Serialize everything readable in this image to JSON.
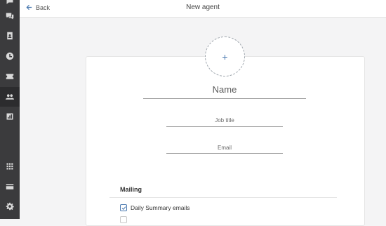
{
  "header": {
    "back_label": "Back",
    "title": "New agent"
  },
  "sidebar": {
    "items": [
      {
        "icon": "chat-icon"
      },
      {
        "icon": "contact-book-icon"
      },
      {
        "icon": "clock-icon"
      },
      {
        "icon": "tickets-icon"
      },
      {
        "icon": "agents-icon",
        "active": true
      },
      {
        "icon": "reports-icon"
      },
      {
        "icon": "apps-grid-icon"
      },
      {
        "icon": "billing-card-icon"
      },
      {
        "icon": "settings-gear-icon"
      }
    ]
  },
  "form": {
    "avatar_symbol": "+",
    "name_placeholder": "Name",
    "job_title_placeholder": "Job title",
    "email_placeholder": "Email"
  },
  "mailing": {
    "title": "Mailing",
    "options": [
      {
        "label": "Daily Summary emails",
        "checked": true
      }
    ]
  },
  "colors": {
    "accent": "#4a79b0",
    "sidebar": "#3b3b3d"
  }
}
